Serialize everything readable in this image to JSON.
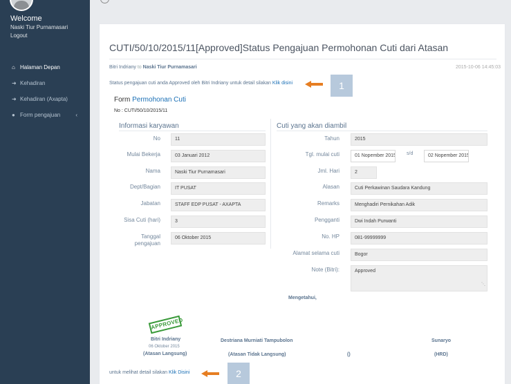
{
  "sidebar": {
    "welcome": "Welcome",
    "user_name": "Naski Tiur Purnamasari",
    "logout": "Logout",
    "items": [
      {
        "label": "Halaman Depan",
        "icon": "home-icon"
      },
      {
        "label": "Kehadiran",
        "icon": "sign-in-icon"
      },
      {
        "label": "Kehadiran (Axapta)",
        "icon": "sign-in-icon"
      },
      {
        "label": "Form pengajuan",
        "icon": "circle-icon"
      }
    ]
  },
  "page": {
    "title": "CUTI/50/10/2015/11[Approved]Status Pengajuan Permohonan Cuti dari Atasan",
    "from": "Bitri Indriany",
    "to_label": "to",
    "to": "Naski Tiur Purnamasari",
    "date": "2015-10-06 14:45:03",
    "status_text": "Status pengajuan cuti anda Approved oleh Bitri Indriany untuk detail silakan",
    "status_link": "Klik disini",
    "marker1": "1",
    "marker2": "2"
  },
  "form": {
    "title_prefix": "Form",
    "title_blue": "Permohonan Cuti",
    "number": "No : CUTI/50/10/2015/11"
  },
  "left": {
    "heading": "Informasi karyawan",
    "no_label": "No",
    "no": "11",
    "mulai_label": "Mulai Bekerja",
    "mulai": "03 Januari 2012",
    "nama_label": "Nama",
    "nama": "Naski Tiur Purnamasari",
    "dept_label": "Dept/Bagian",
    "dept": "IT PUSAT",
    "jabatan_label": "Jabatan",
    "jabatan": "STAFF EDP PUSAT - AXAPTA",
    "sisa_label": "Sisa Cuti (hari)",
    "sisa": "3",
    "tanggal_label_1": "Tanggal",
    "tanggal_label_2": "pengajuan",
    "tanggal": "06 Oktober 2015"
  },
  "right": {
    "heading": "Cuti yang akan diambil",
    "tahun_label": "Tahun",
    "tahun": "2015",
    "tgl_label": "Tgl. mulai cuti",
    "tgl_mulai": "01 Nopember 2015",
    "sd": "s/d",
    "tgl_akhir": "02 Nopember 2015",
    "jml_label": "Jml. Hari",
    "jml": "2",
    "alasan_label": "Alasan",
    "alasan": "Cuti Perkawinan Saudara Kandung",
    "remarks_label": "Remarks",
    "remarks": "Menghadiri Pernikahan Adik",
    "pengganti_label": "Pengganti",
    "pengganti": "Dwi Indah Purwanti",
    "hp_label": "No. HP",
    "hp": "081-99999999",
    "alamat_label": "Alamat selama cuti",
    "alamat": "Bogor",
    "note_label": "Note (Bitri):",
    "note": "Approved"
  },
  "signatures": {
    "mengetahui": "Mengetahui,",
    "stamp": "APPROVED",
    "s1_name": "Bitri Indriany",
    "s1_date": "06 Oktober 2015",
    "s1_role": "(Atasan Langsung)",
    "s2_name": "Destriana Murniati Tampubolon",
    "s2_role": "(Atasan Tidak Langsung)",
    "s3_role": "()",
    "s4_name": "Sunaryo",
    "s4_role": "(HRD)"
  },
  "footer": {
    "text": "untuk melihat detail silakan",
    "link": "Klik Disini"
  },
  "colors": {
    "sidebar": "#2a3f54",
    "accent_arrow": "#e67e22",
    "link": "#1a6fb5",
    "stamp": "#3a9a3a"
  }
}
